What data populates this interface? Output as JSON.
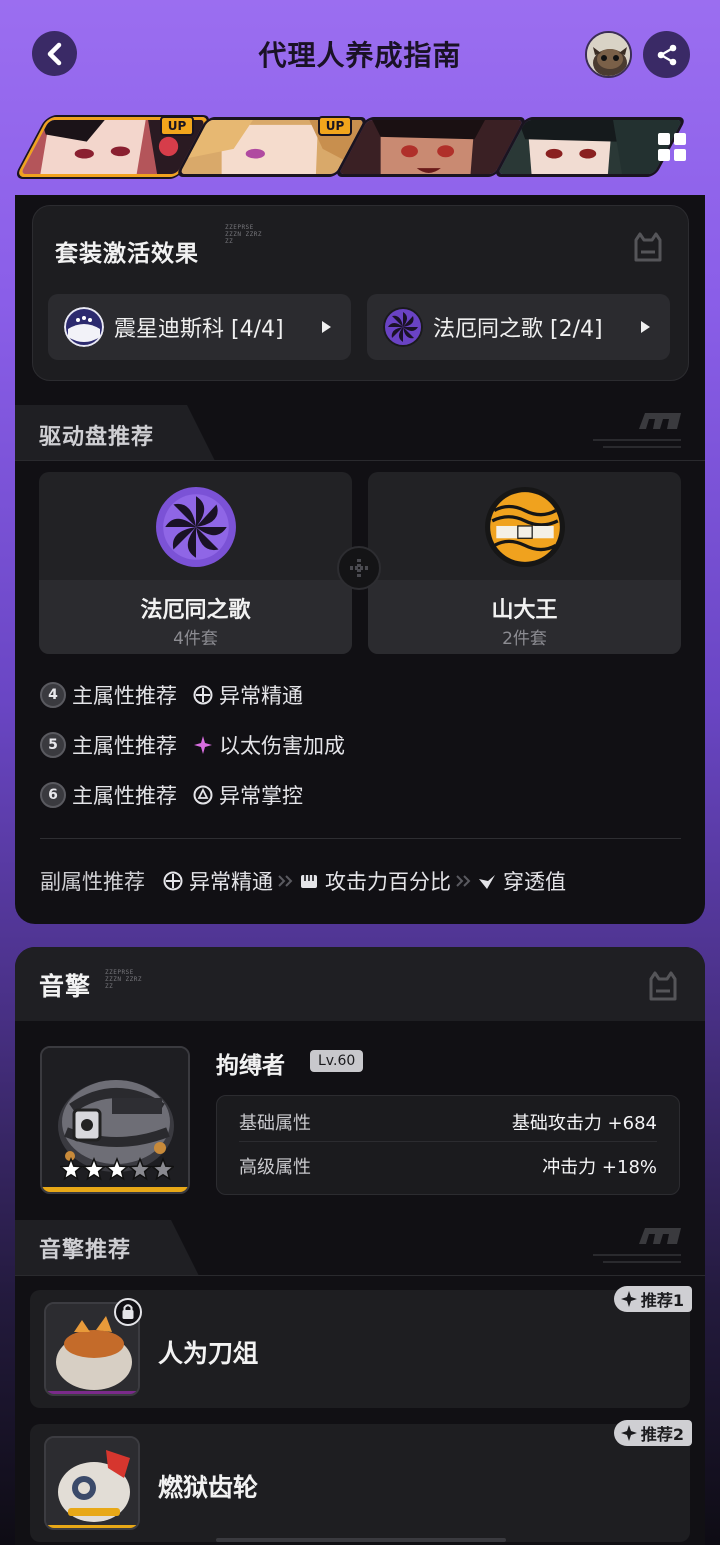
{
  "header": {
    "title": "代理人养成指南"
  },
  "character_tabs": [
    {
      "name": "agent-1",
      "badge": ""
    },
    {
      "name": "agent-2",
      "badge": "UP"
    },
    {
      "name": "agent-3",
      "badge": "UP"
    },
    {
      "name": "agent-4",
      "badge": ""
    }
  ],
  "set_effects": {
    "title": "套装激活效果",
    "code_text": [
      "ZZEPRSE",
      "ZZZN ZZRZ",
      "ZZ"
    ],
    "chips": [
      {
        "label": "震星迪斯科 [4/4]"
      },
      {
        "label": "法厄同之歌 [2/4]"
      }
    ]
  },
  "drive_disc": {
    "tab_label": "驱动盘推荐",
    "discs": [
      {
        "name": "法厄同之歌",
        "sub": "4件套"
      },
      {
        "name": "山大王",
        "sub": "2件套"
      }
    ],
    "main_stats": [
      {
        "slot": "4",
        "label": "主属性推荐",
        "value": "异常精通"
      },
      {
        "slot": "5",
        "label": "主属性推荐",
        "value": "以太伤害加成"
      },
      {
        "slot": "6",
        "label": "主属性推荐",
        "value": "异常掌控"
      }
    ],
    "sub_stats": {
      "label": "副属性推荐",
      "values": [
        "异常精通",
        "攻击力百分比",
        "穿透值"
      ]
    }
  },
  "w_engine": {
    "title": "音擎",
    "code_text": [
      "ZZEPRSE",
      "ZZZN ZZRZ",
      "ZZ"
    ],
    "name": "拘缚者",
    "level": "Lv.60",
    "rarity_filled": 3,
    "rarity_total": 5,
    "attributes": [
      {
        "key": "基础属性",
        "value": "基础攻击力 +684"
      },
      {
        "key": "高级属性",
        "value": "冲击力 +18%"
      }
    ]
  },
  "engine_recommend": {
    "tab_label": "音擎推荐",
    "items": [
      {
        "name": "人为刀俎",
        "badge": "推荐1",
        "locked": true
      },
      {
        "name": "燃狱齿轮",
        "badge": "推荐2",
        "locked": false
      }
    ]
  },
  "colors": {
    "accent_gold": "#f0a21e",
    "purple_bg": "#9b6ef0",
    "panel_bg": "#111014"
  }
}
